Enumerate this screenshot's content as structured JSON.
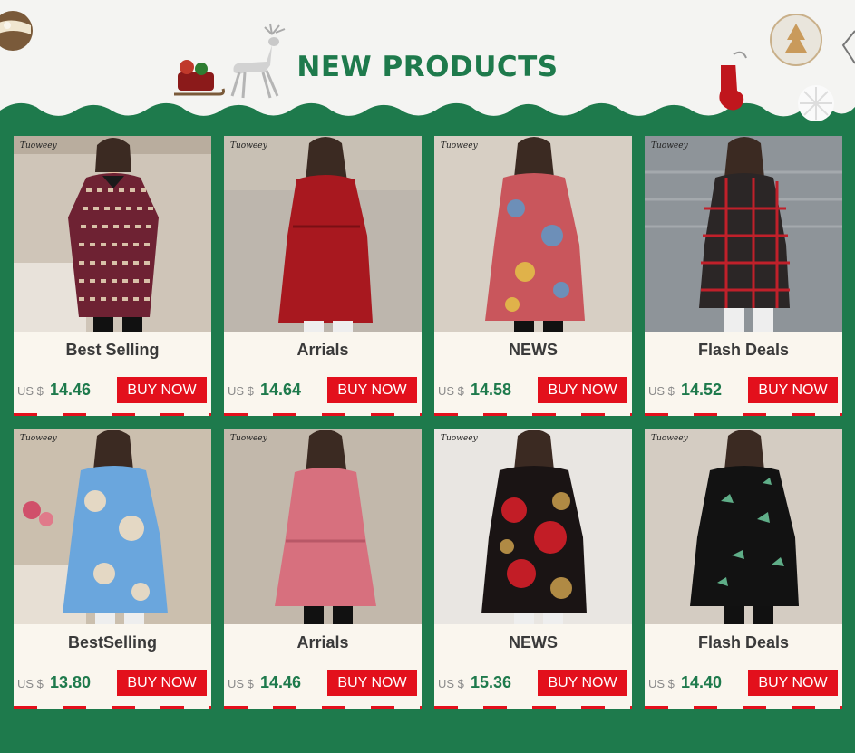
{
  "header": {
    "title": "NEW PRODUCTS"
  },
  "colors": {
    "accent_green": "#1e7a4c",
    "buy_red": "#e3101c",
    "card_bg": "#faf6ee"
  },
  "products": [
    {
      "brand": "Tuoweey",
      "title": "Best Selling",
      "currency": "US $",
      "price": "14.46",
      "button": "BUY NOW"
    },
    {
      "brand": "Tuoweey",
      "title": "Arrials",
      "currency": "US $",
      "price": "14.64",
      "button": "BUY NOW"
    },
    {
      "brand": "Tuoweey",
      "title": "NEWS",
      "currency": "US $",
      "price": "14.58",
      "button": "BUY NOW"
    },
    {
      "brand": "Tuoweey",
      "title": "Flash Deals",
      "currency": "US $",
      "price": "14.52",
      "button": "BUY NOW"
    },
    {
      "brand": "Tuoweey",
      "title": "BestSelling",
      "currency": "US $",
      "price": "13.80",
      "button": "BUY NOW"
    },
    {
      "brand": "Tuoweey",
      "title": "Arrials",
      "currency": "US $",
      "price": "14.46",
      "button": "BUY NOW"
    },
    {
      "brand": "Tuoweey",
      "title": "NEWS",
      "currency": "US $",
      "price": "15.36",
      "button": "BUY NOW"
    },
    {
      "brand": "Tuoweey",
      "title": "Flash Deals",
      "currency": "US $",
      "price": "14.40",
      "button": "BUY NOW"
    }
  ]
}
